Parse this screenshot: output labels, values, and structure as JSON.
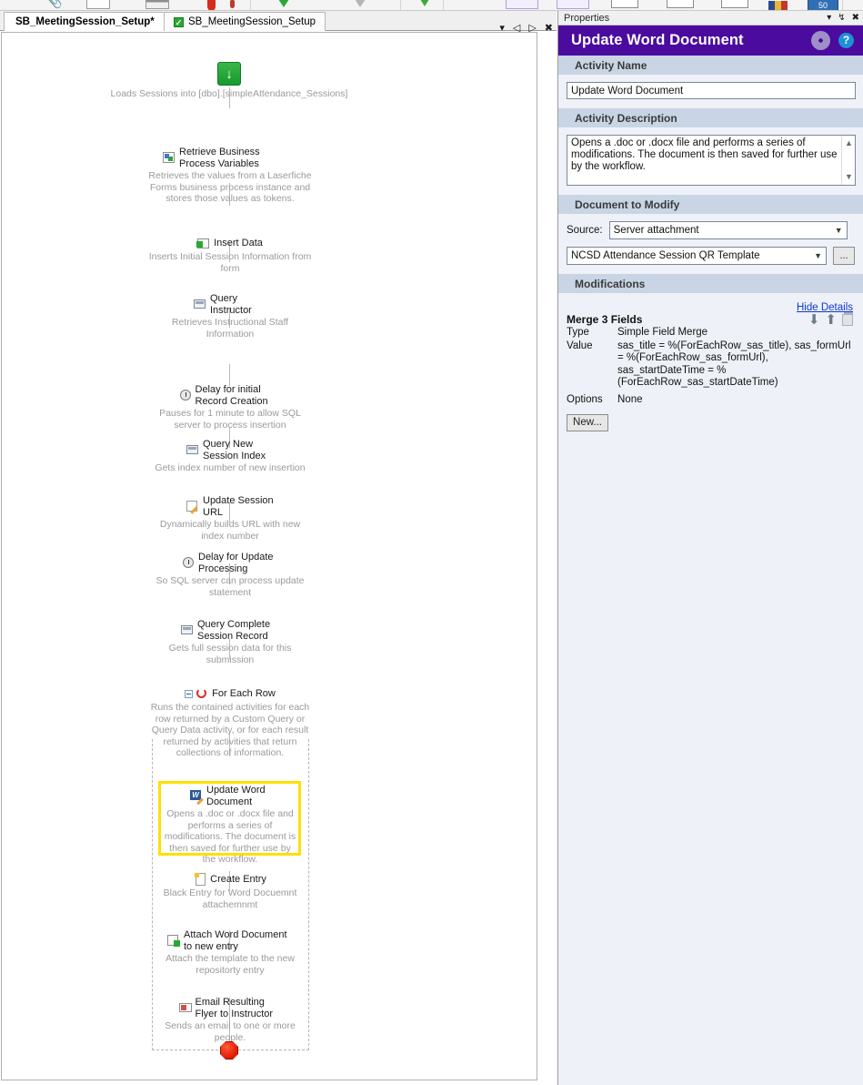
{
  "toolbar": {
    "zoom_badge": "50"
  },
  "tabs": {
    "items": [
      {
        "label": "SB_MeetingSession_Setup*",
        "active": true,
        "has_check": false
      },
      {
        "label": "SB_MeetingSession_Setup",
        "active": false,
        "has_check": true,
        "check": "✓"
      }
    ],
    "nav": {
      "dropdown": "▾",
      "prev": "◁",
      "next": "▷",
      "close": "✖"
    }
  },
  "workflow": {
    "start_label": "Loads Sessions into [dbo].[simpleAttendance_Sessions]",
    "start_icon": "↓",
    "nodes": [
      {
        "title": "Retrieve Business Process Variables",
        "desc": "Retrieves the values from a Laserfiche Forms business process instance and stores those values as tokens.",
        "icon": "business-process-variables-icon"
      },
      {
        "title": "Insert Data",
        "desc": "Inserts Initial Session Information from form",
        "icon": "insert-data-icon"
      },
      {
        "title": "Query Instructor",
        "desc": "Retrieves Instructional Staff Information",
        "icon": "query-icon"
      },
      {
        "title": "Delay for initial Record Creation",
        "desc": "Pauses for 1 minute to allow SQL server to process insertion",
        "icon": "clock-icon"
      },
      {
        "title": "Query New Session Index",
        "desc": "Gets index number of new insertion",
        "icon": "query-icon"
      },
      {
        "title": "Update Session URL",
        "desc": "Dynamically builds URL with new index number",
        "icon": "pencil-icon"
      },
      {
        "title": "Delay for Update Processing",
        "desc": "So SQL server can process update statement",
        "icon": "clock-icon"
      },
      {
        "title": "Query Complete Session Record",
        "desc": "Gets full session data for this submission",
        "icon": "query-icon"
      },
      {
        "title": "For Each Row",
        "desc": "Runs the contained activities for each row returned by a Custom Query or Query Data activity, or for each result returned by activities that return collections of information.",
        "icon": "loop-icon"
      },
      {
        "title": "Update Word Document",
        "desc": "Opens a .doc or .docx file and performs a series of modifications. The document is then saved for further use by the workflow.",
        "icon": "word-icon",
        "selected": true
      },
      {
        "title": "Create Entry",
        "desc": "Black Entry for Word Docuemnt attachemnmt",
        "icon": "entry-icon"
      },
      {
        "title": "Attach Word Document to new entry",
        "desc": "Attach the template to the new repositorty entry",
        "icon": "attach-icon"
      },
      {
        "title": "Email Resulting Flyer to Instructor",
        "desc": "Sends an email to one or more people.",
        "icon": "mail-icon"
      }
    ]
  },
  "properties": {
    "panel_title": "Properties",
    "panel_buttons": {
      "dropdown": "▾",
      "pin": "↯",
      "close": "✖"
    },
    "header_title": "Update Word Document",
    "header_help": "?",
    "accent_color": "#4b0b9e",
    "sections": {
      "activity_name": {
        "heading": "Activity Name",
        "value": "Update Word Document"
      },
      "activity_description": {
        "heading": "Activity Description",
        "value": "Opens a .doc or .docx file and performs a series of modifications. The document is then saved for further use by the workflow."
      },
      "document_to_modify": {
        "heading": "Document to Modify",
        "source_label": "Source:",
        "source_value": "Server attachment",
        "attachment_value": "NCSD Attendance Session QR Template",
        "browse_label": "..."
      },
      "modifications": {
        "heading": "Modifications",
        "hide_details_label": "Hide Details",
        "merge_title_bold": "Merge",
        "merge_title_rest": "3 Fields",
        "type_key": "Type",
        "type_value": "Simple Field Merge",
        "value_key": "Value",
        "value_value": "sas_title = %(ForEachRow_sas_title), sas_formUrl = %(ForEachRow_sas_formUrl), sas_startDateTime = %(ForEachRow_sas_startDateTime)",
        "options_key": "Options",
        "options_value": "None",
        "new_button": "New..."
      }
    }
  }
}
